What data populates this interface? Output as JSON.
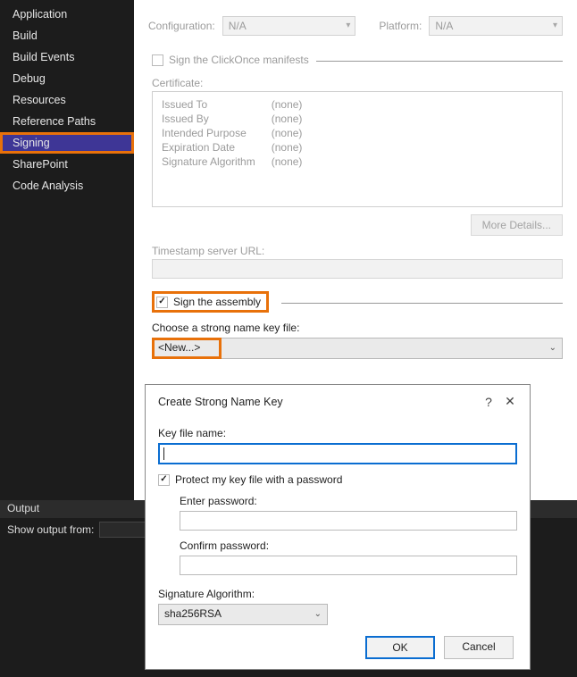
{
  "sidebar": {
    "items": [
      {
        "label": "Application"
      },
      {
        "label": "Build"
      },
      {
        "label": "Build Events"
      },
      {
        "label": "Debug"
      },
      {
        "label": "Resources"
      },
      {
        "label": "Reference Paths"
      },
      {
        "label": "Signing"
      },
      {
        "label": "SharePoint"
      },
      {
        "label": "Code Analysis"
      }
    ]
  },
  "header": {
    "config_label": "Configuration:",
    "config_value": "N/A",
    "platform_label": "Platform:",
    "platform_value": "N/A"
  },
  "signing": {
    "sign_clickonce_label": "Sign the ClickOnce manifests",
    "certificate_label": "Certificate:",
    "cert_rows": [
      {
        "k": "Issued To",
        "v": "(none)"
      },
      {
        "k": "Issued By",
        "v": "(none)"
      },
      {
        "k": "Intended Purpose",
        "v": "(none)"
      },
      {
        "k": "Expiration Date",
        "v": "(none)"
      },
      {
        "k": "Signature Algorithm",
        "v": "(none)"
      }
    ],
    "more_details_btn": "More Details...",
    "timestamp_label": "Timestamp server URL:",
    "sign_assembly_label": "Sign the assembly",
    "choose_key_label": "Choose a strong name key file:",
    "key_dropdown_value": "<New...>"
  },
  "output_panel": {
    "title": "Output",
    "show_from_label": "Show output from:"
  },
  "dialog": {
    "title": "Create Strong Name Key",
    "key_file_label": "Key file name:",
    "key_file_value": "",
    "protect_label": "Protect my key file with a password",
    "enter_pw_label": "Enter password:",
    "confirm_pw_label": "Confirm password:",
    "sig_algo_label": "Signature Algorithm:",
    "sig_algo_value": "sha256RSA",
    "ok_btn": "OK",
    "cancel_btn": "Cancel"
  }
}
